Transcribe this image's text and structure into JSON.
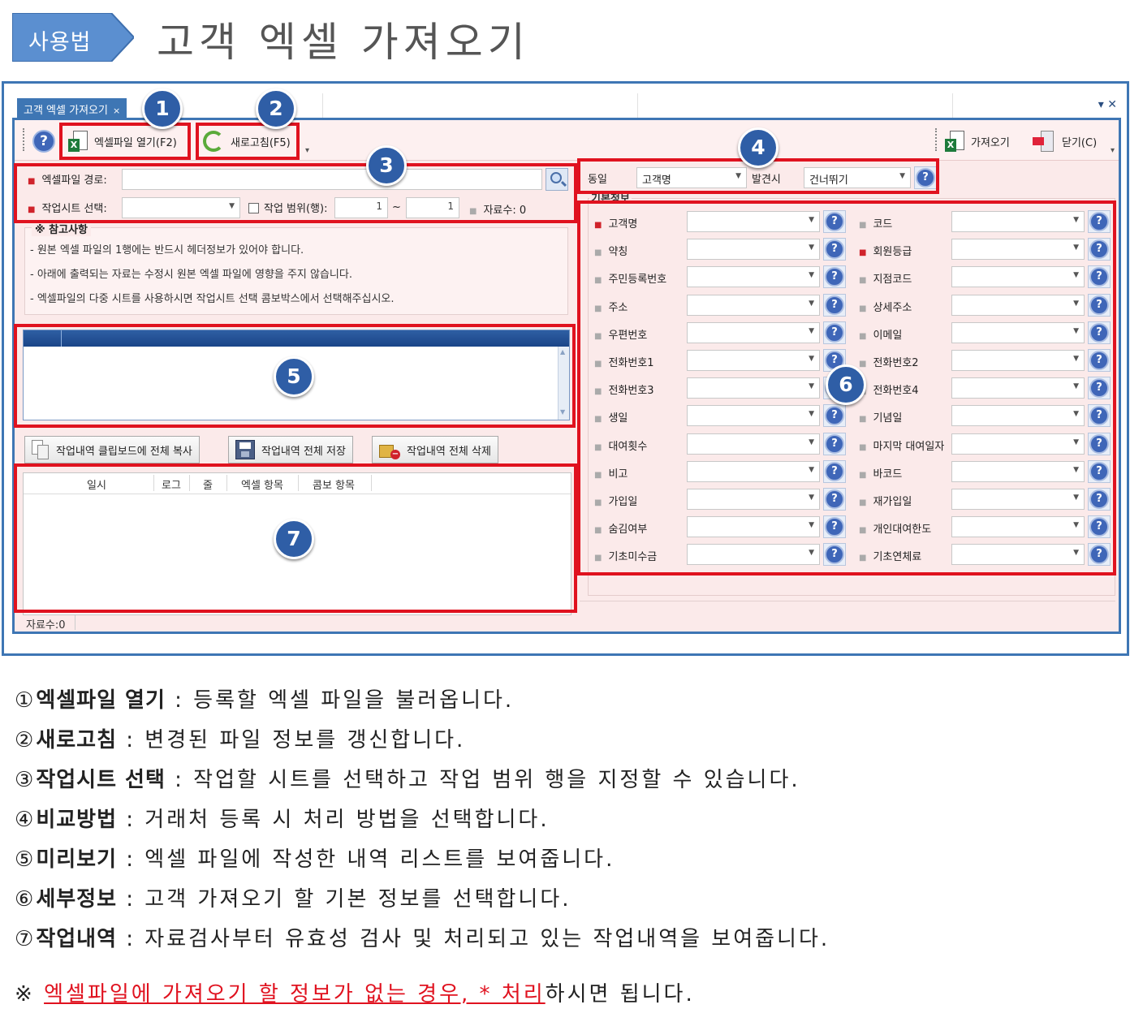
{
  "header": {
    "badge": "사용법",
    "title": "고객 엑셀 가져오기"
  },
  "window": {
    "tab_title": "고객 엑셀 가져오기",
    "tab_close": "×",
    "controls": "▾ ✕"
  },
  "toolbar": {
    "help": "?",
    "open_excel": "엑셀파일 열기(F2)",
    "refresh": "새로고침(F5)",
    "import": "가져오기",
    "close": "닫기(C)"
  },
  "left": {
    "file_path_label": "엑셀파일 경로:",
    "file_path_value": "",
    "sheet_label": "작업시트 선택:",
    "sheet_value": "",
    "range_label": "작업 범위(행):",
    "range_from": "1",
    "range_sep": "~",
    "range_to": "1",
    "count_label": "자료수:",
    "count_value": "0",
    "notes_title": "※ 참고사항",
    "notes": [
      "- 원본 엑셀 파일의 1행에는 반드시 헤더정보가 있어야 합니다.",
      "- 아래에 출력되는 자료는 수정시 원본 엑셀 파일에 영향을 주지 않습니다.",
      "- 엑셀파일의 다중 시트를 사용하시면 작업시트 선택 콤보박스에서 선택해주십시오."
    ],
    "work_buttons": {
      "copy": "작업내역 클립보드에 전체 복사",
      "save": "작업내역 전체 저장",
      "delete": "작업내역 전체 삭제"
    },
    "log_columns": [
      "일시",
      "로그",
      "줄",
      "엑셀 항목",
      "콤보 항목"
    ],
    "record_count": "자료수:0"
  },
  "right": {
    "compare_label": "동일",
    "compare_value": "고객명",
    "found_label": "발견시",
    "found_value": "건너뛰기",
    "group_label": "기본정보",
    "fields_left": [
      {
        "label": "고객명",
        "required": true
      },
      {
        "label": "약칭",
        "required": false
      },
      {
        "label": "주민등록번호",
        "required": false
      },
      {
        "label": "주소",
        "required": false
      },
      {
        "label": "우편번호",
        "required": false
      },
      {
        "label": "전화번호1",
        "required": false
      },
      {
        "label": "전화번호3",
        "required": false
      },
      {
        "label": "생일",
        "required": false
      },
      {
        "label": "대여횟수",
        "required": false
      },
      {
        "label": "비고",
        "required": false
      },
      {
        "label": "가입일",
        "required": false
      },
      {
        "label": "숨김여부",
        "required": false
      },
      {
        "label": "기초미수금",
        "required": false
      }
    ],
    "fields_right": [
      {
        "label": "코드",
        "required": false
      },
      {
        "label": "회원등급",
        "required": true
      },
      {
        "label": "지점코드",
        "required": false
      },
      {
        "label": "상세주소",
        "required": false
      },
      {
        "label": "이메일",
        "required": false
      },
      {
        "label": "전화번호2",
        "required": false
      },
      {
        "label": "전화번호4",
        "required": false
      },
      {
        "label": "기념일",
        "required": false
      },
      {
        "label": "마지막 대여일자",
        "required": false
      },
      {
        "label": "바코드",
        "required": false
      },
      {
        "label": "재가입일",
        "required": false
      },
      {
        "label": "개인대여한도",
        "required": false
      },
      {
        "label": "기초연체료",
        "required": false
      }
    ]
  },
  "callouts": [
    "1",
    "2",
    "3",
    "4",
    "5",
    "6",
    "7"
  ],
  "descriptions": [
    {
      "num": "①",
      "term": "엑셀파일 열기",
      "text": " : 등록할 엑셀 파일을 불러옵니다."
    },
    {
      "num": "②",
      "term": "새로고침",
      "text": " : 변경된 파일 정보를 갱신합니다."
    },
    {
      "num": "③",
      "term": "작업시트 선택",
      "text": " : 작업할 시트를 선택하고 작업 범위 행을 지정할 수 있습니다."
    },
    {
      "num": "④",
      "term": "비교방법",
      "text": " : 거래처 등록 시 처리 방법을 선택합니다."
    },
    {
      "num": "⑤",
      "term": "미리보기",
      "text": " : 엑셀 파일에 작성한 내역 리스트를 보여줍니다."
    },
    {
      "num": "⑥",
      "term": "세부정보",
      "text": " : 고객 가져오기 할 기본 정보를 선택합니다."
    },
    {
      "num": "⑦",
      "term": "작업내역",
      "text": " : 자료검사부터 유효성 검사 및 처리되고 있는 작업내역을 보여줍니다."
    }
  ],
  "footnote": {
    "mark": "※",
    "highlight": "엑셀파일에 가져오기 할 정보가 없는 경우, * 처리",
    "rest": "하시면 됩니다."
  },
  "colors": {
    "accent_blue": "#3e76b4",
    "callout_red": "#e0121f",
    "panel_pink": "#fbeaea"
  }
}
